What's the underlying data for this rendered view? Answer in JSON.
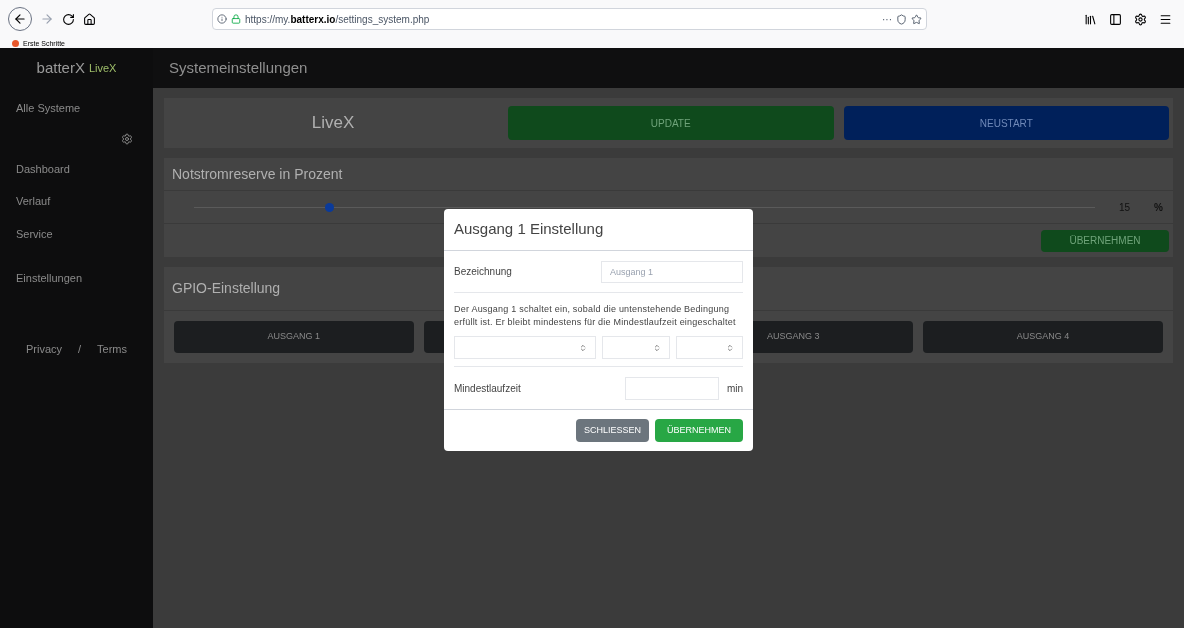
{
  "browser": {
    "url_prefix": "https://my.",
    "url_domain": "batterx.io",
    "url_path": "/settings_system.php",
    "bookmark": "Erste Schritte",
    "menu_glyph": "···"
  },
  "app": {
    "logo_main": "batterX",
    "logo_sub": "LiveX",
    "page_title": "Systemeinstellungen"
  },
  "sidebar": {
    "items": [
      {
        "label": "Alle Systeme",
        "selected": false
      },
      {
        "label": "Dashboard",
        "selected": false
      },
      {
        "label": "Verlauf",
        "selected": false
      },
      {
        "label": "Service",
        "selected": false
      },
      {
        "label": "Einstellungen",
        "selected": false
      }
    ],
    "footer": [
      "Privacy",
      "/",
      "Terms"
    ]
  },
  "system_card": {
    "name": "LiveX",
    "update": "UPDATE",
    "restart": "NEUSTART"
  },
  "reserve": {
    "title": "Notstromreserve in Prozent",
    "level": 0.15,
    "value": "15",
    "unit": "%",
    "apply": "ÜBERNEHMEN"
  },
  "gpio": {
    "title": "GPIO-Einstellung",
    "outputs": [
      {
        "kind": "labeled",
        "label": "AUSGANG 1"
      },
      {
        "kind": "covered"
      },
      {
        "kind": "labeled",
        "label": "AUSGANG 3"
      },
      {
        "kind": "labeled",
        "label": "AUSGANG 4"
      }
    ]
  },
  "dialog": {
    "title": "Ausgang 1 Einstellung",
    "name_label": "Bezeichnung",
    "name_placeholder": "Ausgang 1",
    "description": "Der Ausgang 1 schaltet ein, sobald die untenstehende Bedingung erfüllt ist. Er bleibt mindestens für die Mindestlaufzeit eingeschaltet",
    "min_label": "Mindestlaufzeit",
    "min_unit": "min",
    "close": "SCHLIESSEN",
    "apply": "ÜBERNEHMEN"
  }
}
